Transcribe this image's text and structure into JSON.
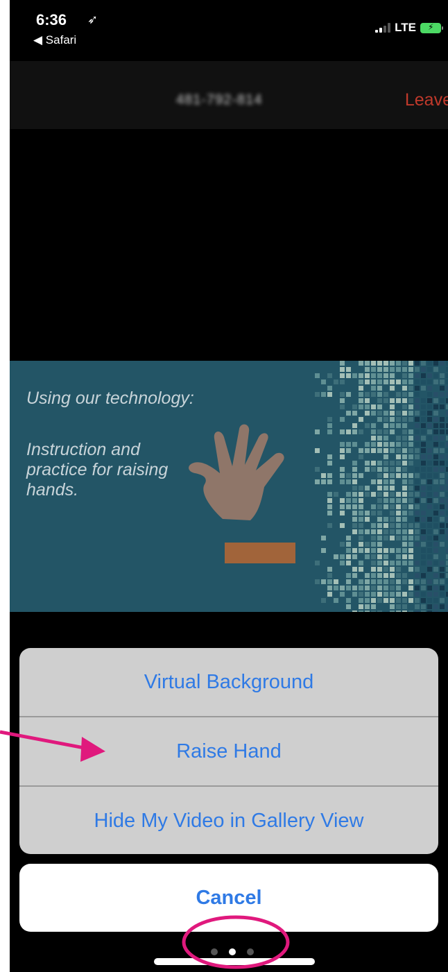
{
  "status_bar": {
    "time": "6:36",
    "location_icon": "location-arrow-icon",
    "back_label": "◀ Safari",
    "network": "LTE"
  },
  "meeting": {
    "id_text": "481-792-814",
    "leave_label": "Leave"
  },
  "slide": {
    "title": "Using our technology:",
    "body": "Instruction and practice for raising hands."
  },
  "action_sheet": {
    "items": [
      {
        "label": "Virtual Background"
      },
      {
        "label": "Raise Hand"
      },
      {
        "label": "Hide My Video in Gallery View"
      }
    ],
    "cancel_label": "Cancel"
  },
  "colors": {
    "accent_blue": "#2f7ae5",
    "annotation_pink": "#e0197d",
    "slide_teal": "#235566",
    "leave_red": "#c0392b"
  }
}
